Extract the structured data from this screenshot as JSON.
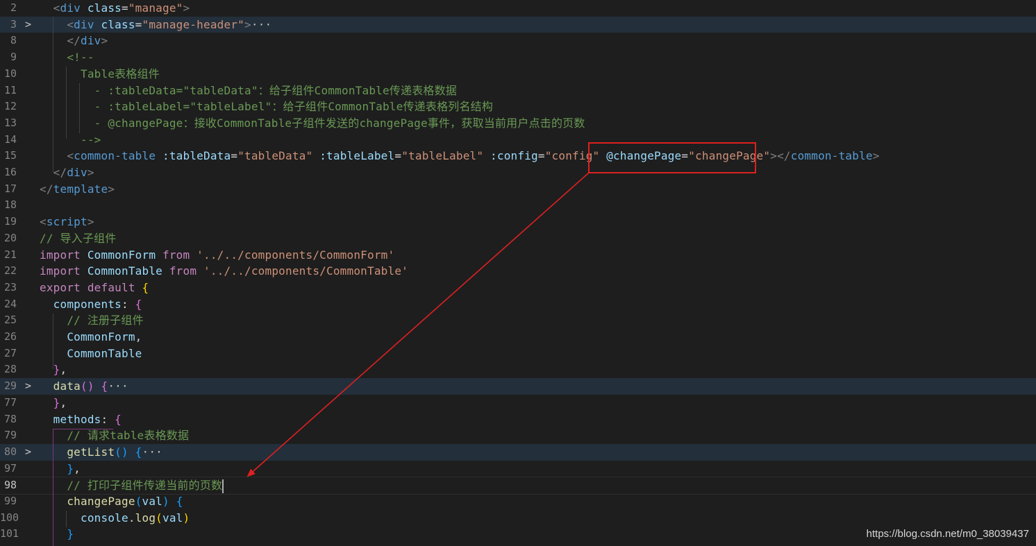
{
  "lines": [
    {
      "n": "2",
      "code": [
        [
          "tag",
          "  <"
        ],
        [
          "tn",
          "div"
        ],
        [
          "at",
          " class"
        ],
        [
          "pl",
          "="
        ],
        [
          "st",
          "\"manage\""
        ],
        [
          "tag",
          ">"
        ]
      ]
    },
    {
      "n": "3",
      "fold": ">",
      "hl": true,
      "code": [
        [
          "tag",
          "    <"
        ],
        [
          "tn",
          "div"
        ],
        [
          "at",
          " class"
        ],
        [
          "pl",
          "="
        ],
        [
          "st",
          "\"manage-header\""
        ],
        [
          "tag",
          ">"
        ],
        [
          "dots",
          "···"
        ]
      ]
    },
    {
      "n": "8",
      "code": [
        [
          "tag",
          "    </"
        ],
        [
          "tn",
          "div"
        ],
        [
          "tag",
          ">"
        ]
      ]
    },
    {
      "n": "9",
      "code": [
        [
          "cm",
          "    <!--"
        ]
      ]
    },
    {
      "n": "10",
      "code": [
        [
          "cm",
          "      Table表格组件"
        ]
      ]
    },
    {
      "n": "11",
      "code": [
        [
          "cm",
          "        - :tableData=\"tableData\"：给子组件CommonTable传递表格数据"
        ]
      ]
    },
    {
      "n": "12",
      "code": [
        [
          "cm",
          "        - :tableLabel=\"tableLabel\"：给子组件CommonTable传递表格列名结构"
        ]
      ]
    },
    {
      "n": "13",
      "code": [
        [
          "cm",
          "        - @changePage：接收CommonTable子组件发送的changePage事件，获取当前用户点击的页数"
        ]
      ]
    },
    {
      "n": "14",
      "code": [
        [
          "cm",
          "      -->"
        ]
      ]
    },
    {
      "n": "15",
      "code": [
        [
          "tag",
          "    <"
        ],
        [
          "tn",
          "common-table"
        ],
        [
          "at",
          " :tableData"
        ],
        [
          "pl",
          "="
        ],
        [
          "st",
          "\"tableData\""
        ],
        [
          "at",
          " :tableLabel"
        ],
        [
          "pl",
          "="
        ],
        [
          "st",
          "\"tableLabel\""
        ],
        [
          "at",
          " :config"
        ],
        [
          "pl",
          "="
        ],
        [
          "st",
          "\"config\""
        ],
        [
          "at",
          " @changePage"
        ],
        [
          "pl",
          "="
        ],
        [
          "st",
          "\"changePage\""
        ],
        [
          "tag",
          ">"
        ],
        [
          "tag",
          "</"
        ],
        [
          "tn",
          "common-table"
        ],
        [
          "tag",
          ">"
        ]
      ]
    },
    {
      "n": "16",
      "code": [
        [
          "tag",
          "  </"
        ],
        [
          "tn",
          "div"
        ],
        [
          "tag",
          ">"
        ]
      ]
    },
    {
      "n": "17",
      "code": [
        [
          "tag",
          "</"
        ],
        [
          "tn",
          "template"
        ],
        [
          "tag",
          ">"
        ]
      ]
    },
    {
      "n": "18",
      "code": [
        [
          "pl",
          ""
        ]
      ]
    },
    {
      "n": "19",
      "code": [
        [
          "tag",
          "<"
        ],
        [
          "tn",
          "script"
        ],
        [
          "tag",
          ">"
        ]
      ]
    },
    {
      "n": "20",
      "code": [
        [
          "cm",
          "// 导入子组件"
        ]
      ]
    },
    {
      "n": "21",
      "code": [
        [
          "kw",
          "import"
        ],
        [
          "id",
          " CommonForm"
        ],
        [
          "kw",
          " from"
        ],
        [
          "st",
          " '../../components/CommonForm'"
        ]
      ]
    },
    {
      "n": "22",
      "code": [
        [
          "kw",
          "import"
        ],
        [
          "id",
          " CommonTable"
        ],
        [
          "kw",
          " from"
        ],
        [
          "st",
          " '../../components/CommonTable'"
        ]
      ]
    },
    {
      "n": "23",
      "code": [
        [
          "kw",
          "export"
        ],
        [
          "kw",
          " default"
        ],
        [
          "br1",
          " {"
        ]
      ]
    },
    {
      "n": "24",
      "code": [
        [
          "id",
          "  components"
        ],
        [
          "pl",
          ": "
        ],
        [
          "br2",
          "{"
        ]
      ]
    },
    {
      "n": "25",
      "code": [
        [
          "cm",
          "    // 注册子组件"
        ]
      ]
    },
    {
      "n": "26",
      "code": [
        [
          "id",
          "    CommonForm"
        ],
        [
          "pl",
          ","
        ]
      ]
    },
    {
      "n": "27",
      "code": [
        [
          "id",
          "    CommonTable"
        ]
      ]
    },
    {
      "n": "28",
      "code": [
        [
          "br2",
          "  }"
        ],
        [
          "pl",
          ","
        ]
      ]
    },
    {
      "n": "29",
      "fold": ">",
      "hl": true,
      "code": [
        [
          "fn",
          "  data"
        ],
        [
          "br2",
          "()"
        ],
        [
          "br2",
          " {"
        ],
        [
          "dots",
          "···"
        ]
      ]
    },
    {
      "n": "77",
      "code": [
        [
          "br2",
          "  }"
        ],
        [
          "pl",
          ","
        ]
      ]
    },
    {
      "n": "78",
      "code": [
        [
          "id",
          "  methods"
        ],
        [
          "pl",
          ": "
        ],
        [
          "br2",
          "{"
        ]
      ]
    },
    {
      "n": "79",
      "code": [
        [
          "cm",
          "    // 请求table表格数据"
        ]
      ]
    },
    {
      "n": "80",
      "fold": ">",
      "hl": true,
      "code": [
        [
          "fn",
          "    getList"
        ],
        [
          "br3",
          "()"
        ],
        [
          "br3",
          " {"
        ],
        [
          "dots",
          "···"
        ]
      ]
    },
    {
      "n": "97",
      "code": [
        [
          "br3",
          "    }"
        ],
        [
          "pl",
          ","
        ]
      ]
    },
    {
      "n": "98",
      "active": true,
      "cur": true,
      "cursor": true,
      "code": [
        [
          "cm",
          "    // 打印子组件传递当前的页数"
        ]
      ]
    },
    {
      "n": "99",
      "code": [
        [
          "fn",
          "    changePage"
        ],
        [
          "br3",
          "("
        ],
        [
          "id",
          "val"
        ],
        [
          "br3",
          ")"
        ],
        [
          "br3",
          " {"
        ]
      ]
    },
    {
      "n": "100",
      "code": [
        [
          "id",
          "      console"
        ],
        [
          "pl",
          "."
        ],
        [
          "fn",
          "log"
        ],
        [
          "br1",
          "("
        ],
        [
          "id",
          "val"
        ],
        [
          "br1",
          ")"
        ]
      ]
    },
    {
      "n": "101",
      "code": [
        [
          "br3",
          "    }"
        ]
      ]
    }
  ],
  "watermark": "https://blog.csdn.net/m0_38039437",
  "colors": {
    "background": "#1e1e1e",
    "annotation": "#e02020"
  }
}
